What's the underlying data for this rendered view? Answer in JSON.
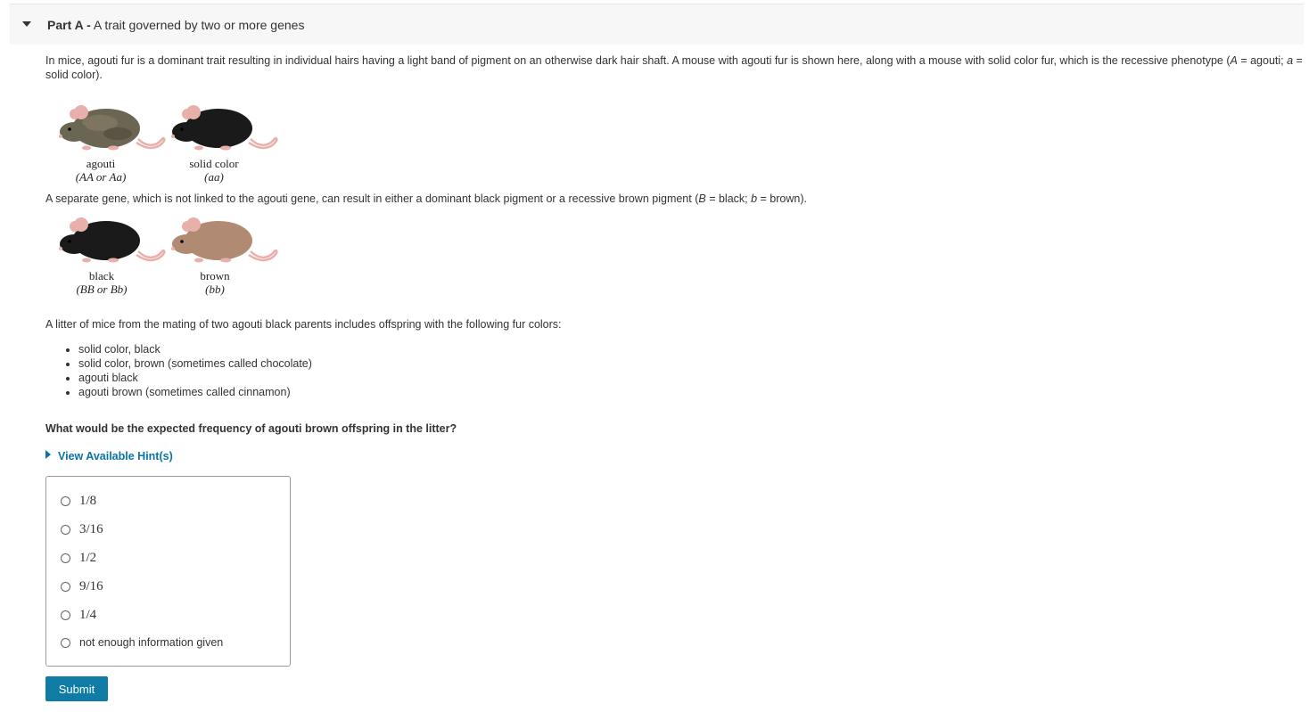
{
  "part": {
    "label": "Part A -",
    "title": "A trait governed by two or more genes"
  },
  "intro": {
    "text1": "In mice, agouti fur is a dominant trait resulting in individual hairs having a light band of pigment on an otherwise dark hair shaft. A mouse with agouti fur is shown here, along with a mouse with solid color fur, which is the recessive phenotype (",
    "A": "A",
    "eq1": " = agouti; ",
    "a": "a",
    "eq2": " = solid color)."
  },
  "figure1": [
    {
      "name": "agouti",
      "genotype": "(AA or Aa)",
      "fur_color": "#6b6553"
    },
    {
      "name": "solid color",
      "genotype": "(aa)",
      "fur_color": "#1a1a1a"
    }
  ],
  "gene2": {
    "text1": "A separate gene, which is not linked to the agouti gene, can result in either a dominant black pigment or a recessive brown pigment (",
    "B": "B",
    "eq1": " = black; ",
    "b": "b",
    "eq2": " = brown)."
  },
  "figure2": [
    {
      "name": "black",
      "genotype": "(BB or Bb)",
      "fur_color": "#1a1a1a"
    },
    {
      "name": "brown",
      "genotype": "(bb)",
      "fur_color": "#b08a72"
    }
  ],
  "litter_text": "A litter of mice from the mating of two agouti black parents includes offspring with the following fur colors:",
  "offspring": [
    "solid color, black",
    "solid color, brown (sometimes called chocolate)",
    "agouti black",
    "agouti brown (sometimes called cinnamon)"
  ],
  "question": "What would be the expected frequency of agouti brown offspring in the litter?",
  "hint_label": "View Available Hint(s)",
  "choices": [
    {
      "label": "1/8",
      "math": true
    },
    {
      "label": "3/16",
      "math": true
    },
    {
      "label": "1/2",
      "math": true
    },
    {
      "label": "9/16",
      "math": true
    },
    {
      "label": "1/4",
      "math": true
    },
    {
      "label": "not enough information given",
      "math": false
    }
  ],
  "submit_label": "Submit",
  "colors": {
    "accent": "#0f7ca5",
    "link": "#0a74a8",
    "ear_pink": "#e8b0aa"
  }
}
